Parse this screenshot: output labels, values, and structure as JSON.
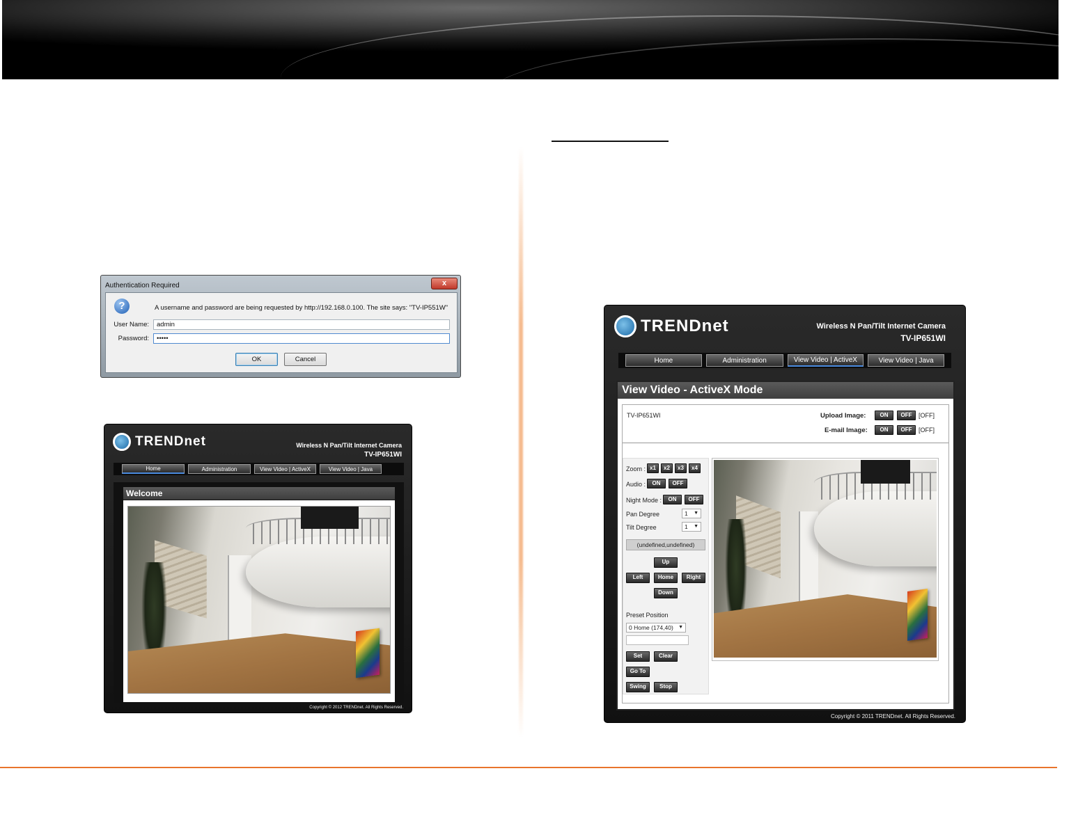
{
  "auth_dialog": {
    "title": "Authentication Required",
    "close_label": "x",
    "message": "A username and password are being requested by http://192.168.0.100. The site says: \"TV-IP551W\"",
    "username_label": "User Name:",
    "username_value": "admin",
    "password_label": "Password:",
    "password_value": "•••••",
    "ok_label": "OK",
    "cancel_label": "Cancel"
  },
  "cam_left": {
    "brand": "TRENDnet",
    "product": "Wireless N Pan/Tilt Internet Camera",
    "model": "TV-IP651WI",
    "nav": [
      {
        "label": "Home"
      },
      {
        "label": "Administration"
      },
      {
        "label": "View Video | ActiveX"
      },
      {
        "label": "View Video | Java"
      }
    ],
    "section_title": "Welcome",
    "copyright": "Copyright © 2012 TRENDnet.  All Rights Reserved."
  },
  "cam_right": {
    "brand": "TRENDnet",
    "product": "Wireless N Pan/Tilt Internet Camera",
    "model": "TV-IP651WI",
    "nav": [
      {
        "label": "Home"
      },
      {
        "label": "Administration"
      },
      {
        "label": "View Video | ActiveX"
      },
      {
        "label": "View Video | Java"
      }
    ],
    "section_title": "View Video - ActiveX Mode",
    "device_name": "TV-IP651WI",
    "upload_label": "Upload Image:",
    "email_label": "E-mail Image:",
    "on_label": "ON",
    "off_label": "OFF",
    "upload_state": "[OFF]",
    "email_state": "[OFF]",
    "zoom_label": "Zoom :",
    "zoom_options": [
      "x1",
      "x2",
      "x3",
      "x4"
    ],
    "audio_label": "Audio :",
    "night_label": "Night Mode :",
    "pan_label": "Pan Degree",
    "pan_value": "1",
    "tilt_label": "Tilt Degree",
    "tilt_value": "1",
    "coords": "(undefined,undefined)",
    "up_label": "Up",
    "left_label": "Left",
    "home_label": "Home",
    "right_label": "Right",
    "down_label": "Down",
    "preset_label": "Preset Position",
    "preset_value": "0 Home (174,40)",
    "set_label": "Set",
    "clear_label": "Clear",
    "goto_label": "Go To",
    "swing_label": "Swing",
    "stop_label": "Stop",
    "copyright": "Copyright © 2011 TRENDnet. All Rights Reserved."
  },
  "colors": {
    "accent_orange": "#e8742c",
    "nav_active": "#4a8be0"
  }
}
